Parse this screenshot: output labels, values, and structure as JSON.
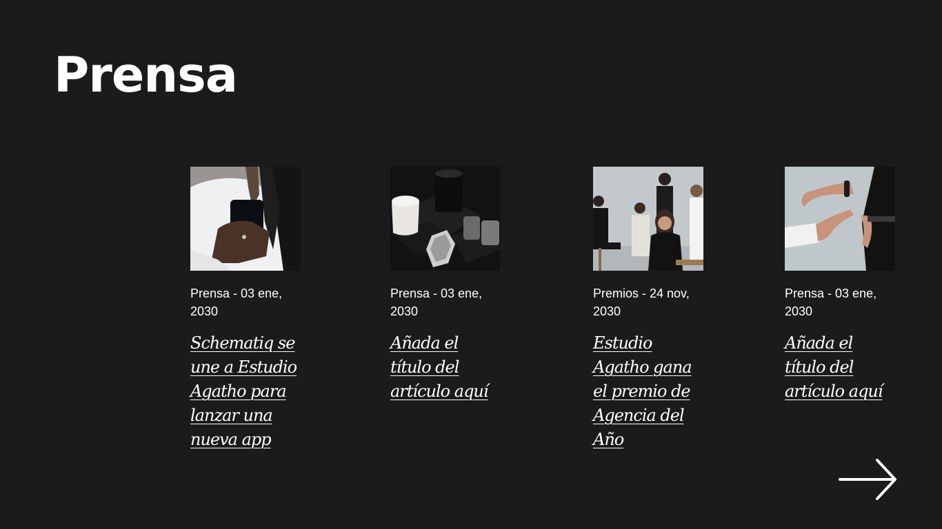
{
  "page": {
    "title": "Prensa"
  },
  "articles": [
    {
      "meta": "Prensa - 03 ene, 2030",
      "title": "Schematiq se une a Estudio Agatho para lanzar una nueva app",
      "image": "woman-holding-phone"
    },
    {
      "meta": "Prensa - 03 ene, 2030",
      "title": "Añada el título del artículo aquí",
      "image": "black-coffee-cups"
    },
    {
      "meta": "Premios - 24 nov, 2030",
      "title": "Estudio Agatho gana el premio de Agencia del Año",
      "image": "group-portrait"
    },
    {
      "meta": "Prensa - 03 ene, 2030",
      "title": "Añada el título del artículo aquí",
      "image": "hands-gesture"
    }
  ],
  "navigation": {
    "next_icon": "arrow-right-icon"
  },
  "colors": {
    "background": "#1b1b1c",
    "text": "#ffffff"
  }
}
